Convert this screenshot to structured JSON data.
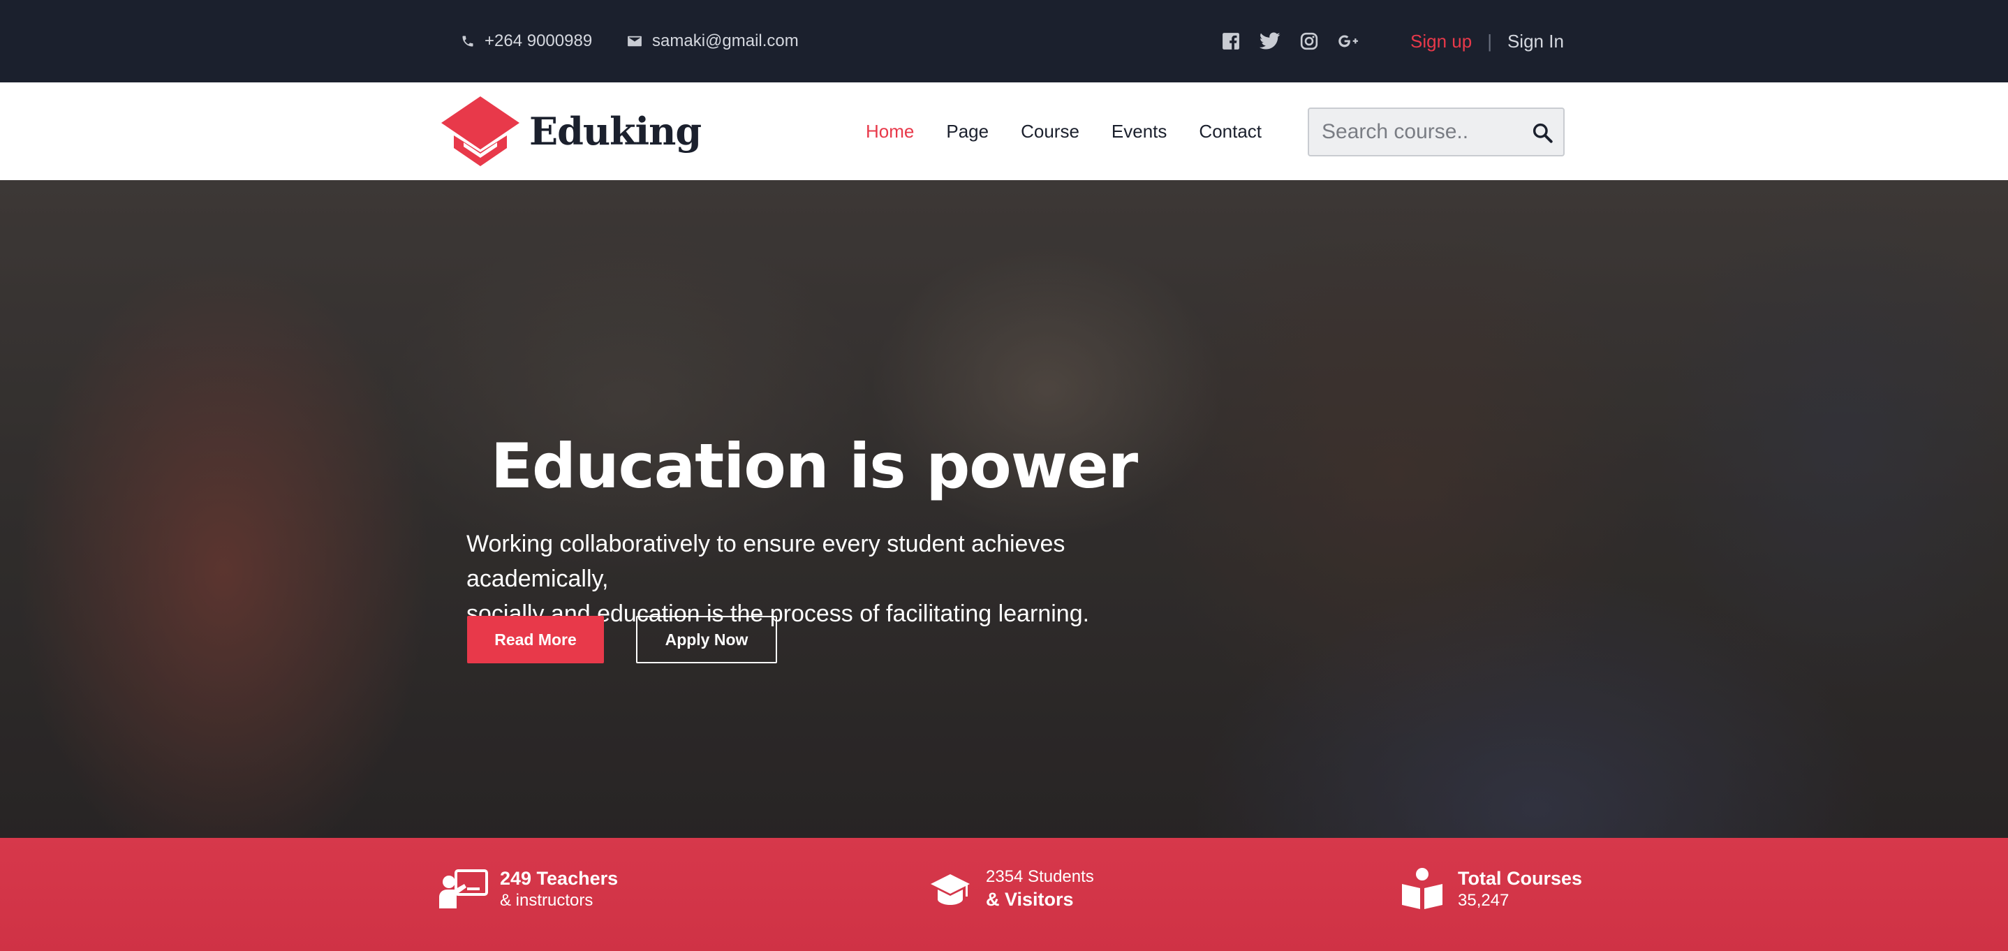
{
  "topbar": {
    "phone": "+264 9000989",
    "email": "samaki@gmail.com",
    "socials": [
      "facebook-icon",
      "twitter-icon",
      "instagram-icon",
      "google-plus-icon"
    ],
    "signup_label": "Sign up",
    "separator": "|",
    "signin_label": "Sign In"
  },
  "nav": {
    "logo_text": "Eduking",
    "items": [
      {
        "label": "Home",
        "active": true
      },
      {
        "label": "Page",
        "active": false
      },
      {
        "label": "Course",
        "active": false
      },
      {
        "label": "Events",
        "active": false
      },
      {
        "label": "Contact",
        "active": false
      }
    ],
    "search_placeholder": "Search course.."
  },
  "hero": {
    "title": "Education is power",
    "subtitle_line1": "Working collaboratively to ensure every student achieves academically,",
    "subtitle_line2": "socially and education is the process of facilitating learning.",
    "read_more_label": "Read More",
    "apply_now_label": "Apply Now"
  },
  "stats": [
    {
      "icon": "teacher-icon",
      "line1": "249 Teachers",
      "line2": "& instructors"
    },
    {
      "icon": "graduation-cap-icon",
      "line1": "2354 Students",
      "line2": "& Visitors"
    },
    {
      "icon": "book-reader-icon",
      "line1": "Total Courses",
      "line2": "35,247"
    }
  ],
  "colors": {
    "accent": "#e8394a",
    "topbar_bg": "#1b202d",
    "stats_bg": "#d7384b"
  }
}
